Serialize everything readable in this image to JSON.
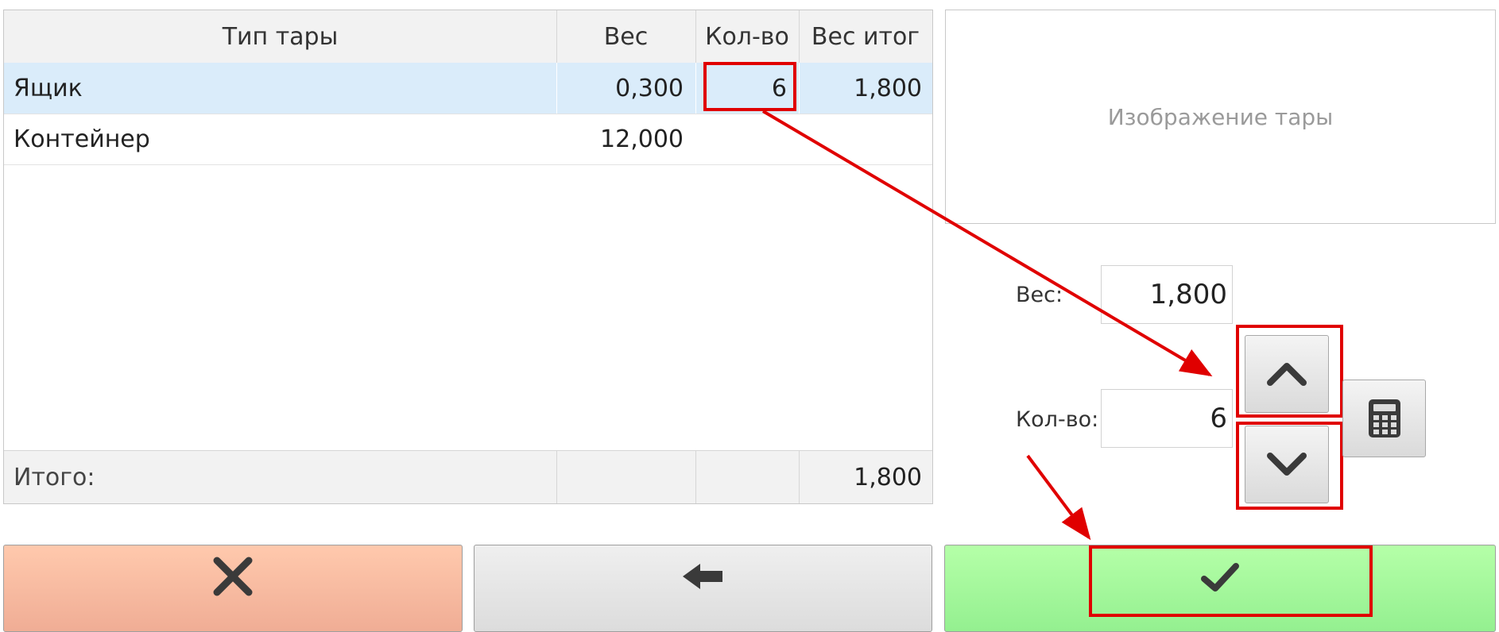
{
  "table": {
    "headers": [
      "Тип тары",
      "Вес",
      "Кол-во",
      "Вес итог"
    ],
    "rows": [
      {
        "type": "Ящик",
        "weight": "0,300",
        "qty": "6",
        "total": "1,800"
      },
      {
        "type": "Контейнер",
        "weight": "12,000",
        "qty": "",
        "total": ""
      }
    ],
    "footer": {
      "label": "Итого:",
      "total": "1,800"
    }
  },
  "image_placeholder": "Изображение тары",
  "form": {
    "weight_label": "Вес:",
    "weight_value": "1,800",
    "qty_label": "Кол-во:",
    "qty_value": "6"
  },
  "icons": {
    "increment": "chevron-up-icon",
    "decrement": "chevron-down-icon",
    "calculator": "calculator-icon",
    "cancel": "close-icon",
    "back": "arrow-left-icon",
    "confirm": "checkmark-icon"
  },
  "colors": {
    "selected_row": "#daecfa",
    "cancel_button": "#f6b9a0",
    "confirm_button": "#a3f79a",
    "highlight": "#e00000"
  }
}
